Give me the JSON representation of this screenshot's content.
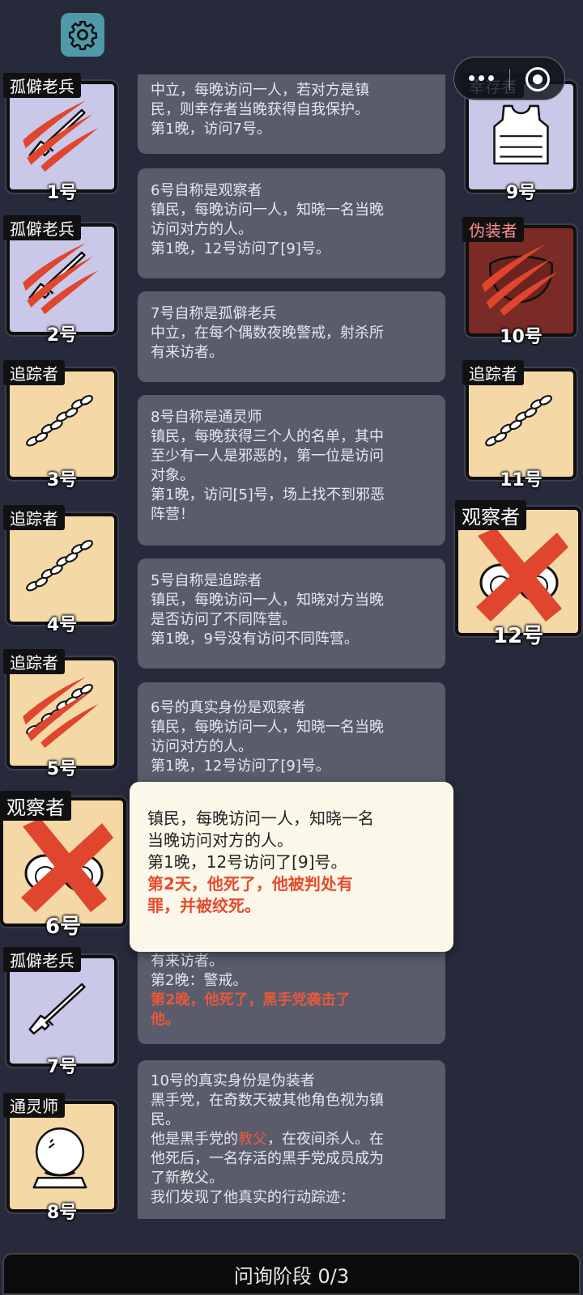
{
  "phase": "问询阶段 0/3",
  "players": [
    {
      "num": "1号",
      "role": "孤僻老兵",
      "art": "rifle-icon",
      "dead": true
    },
    {
      "num": "2号",
      "role": "孤僻老兵",
      "art": "rifle-icon",
      "dead": true
    },
    {
      "num": "3号",
      "role": "追踪者",
      "art": "footprints-icon",
      "dead": false
    },
    {
      "num": "4号",
      "role": "追踪者",
      "art": "footprints-icon",
      "dead": false
    },
    {
      "num": "5号",
      "role": "追踪者",
      "art": "footprints-icon",
      "dead": true
    },
    {
      "num": "6号",
      "role": "观察者",
      "art": "binoculars-icon",
      "lynched": true
    },
    {
      "num": "7号",
      "role": "孤僻老兵",
      "art": "rifle-icon",
      "dead": false
    },
    {
      "num": "8号",
      "role": "通灵师",
      "art": "crystal-ball-icon",
      "dead": false
    },
    {
      "num": "9号",
      "role": "幸存者",
      "art": "vest-icon",
      "dead": false
    },
    {
      "num": "10号",
      "role": "伪装者",
      "art": "mask-icon",
      "dead": true
    },
    {
      "num": "11号",
      "role": "追踪者",
      "art": "footprints-icon",
      "dead": false
    },
    {
      "num": "12号",
      "role": "观察者",
      "art": "binoculars-icon",
      "lynched": true
    }
  ],
  "log": [
    {
      "lines": [
        "中立，每晚访问一人，若对方是镇",
        "民，则幸存者当晚获得自我保护。",
        "第1晚，访问7号。"
      ]
    },
    {
      "lines": [
        "6号自称是观察者",
        "镇民，每晚访问一人，知晓一名当晚",
        "访问对方的人。",
        "第1晚，12号访问了[9]号。"
      ]
    },
    {
      "lines": [
        "7号自称是孤僻老兵",
        "中立，在每个偶数夜晚警戒，射杀所",
        "有来访者。"
      ]
    },
    {
      "lines": [
        "8号自称是通灵师",
        "镇民，每晚获得三个人的名单，其中",
        "至少有一人是邪恶的，第一位是访问",
        "对象。",
        "第1晚，访问[5]号，场上找不到邪恶",
        "阵营！"
      ]
    },
    {
      "lines": [
        "5号自称是追踪者",
        "镇民，每晚访问一人，知晓对方当晚",
        "是否访问了不同阵营。",
        "第1晚，9号没有访问不同阵营。"
      ]
    },
    {
      "lines": [
        "6号的真实身份是观察者",
        "镇民，每晚访问一人，知晓一名当晚",
        "访问对方的人。",
        "第1晚，12号访问了[9]号。"
      ]
    },
    {
      "lines": [
        "有来访者。",
        "第2晚：警戒。"
      ],
      "death": [
        "第2晚，他死了，黑手党袭击了",
        "他。"
      ]
    },
    {
      "line1": "10号的真实身份是伪装者",
      "line2": "黑手党，在奇数天被其他角色视为镇",
      "line3": "民。",
      "line4_pre": "他是黑手党的",
      "line4_hl": "教父",
      "line4_post": "，在夜间杀人。在",
      "line5": "他死后，一名存活的黑手党成员成为",
      "line6": "了新教父。",
      "line7": "我们发现了他真实的行动踪迹："
    }
  ],
  "popup": {
    "lines": [
      "镇民，每晚访问一人，知晓一名",
      "当晚访问对方的人。",
      "第1晚，12号访问了[9]号。"
    ],
    "death": [
      "第2天，他死了，他被判处有",
      "罪，并被绞死。"
    ]
  }
}
